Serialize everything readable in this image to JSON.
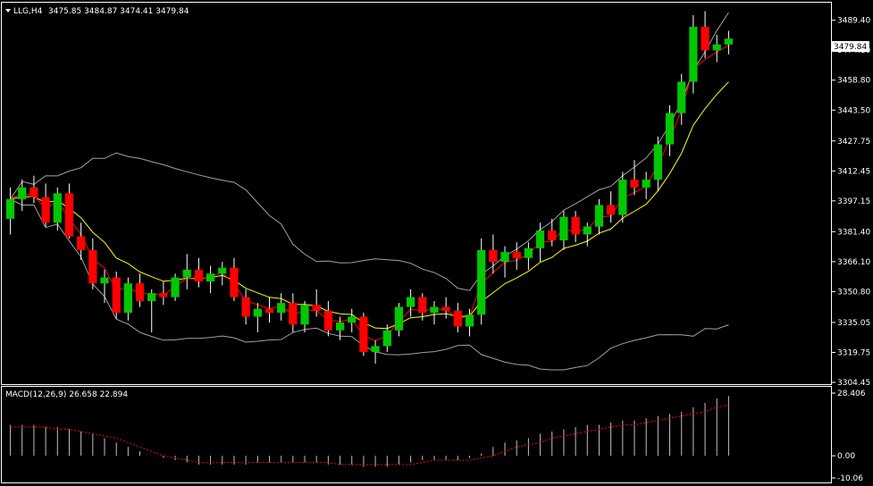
{
  "header": {
    "menu_icon": "triangle-down-icon",
    "symbol_text": "LLG,H4",
    "ohlc_text": "3475.85 3484.87 3474.41 3479.84"
  },
  "price_panel": {
    "current_price_label": "3479.84",
    "axis_ticks": [
      "3489.40",
      "3474.10",
      "3458.80",
      "3443.50",
      "3427.75",
      "3412.45",
      "3397.15",
      "3381.40",
      "3366.10",
      "3350.80",
      "3335.05",
      "3319.75",
      "3304.45"
    ]
  },
  "macd_panel": {
    "label": "MACD(12,26,9) 26.658 22.894",
    "axis_ticks": [
      "28.406",
      "0.00",
      "-10.06"
    ]
  },
  "colors": {
    "background": "#000000",
    "bull_candle": "#00c800",
    "bear_candle": "#ff0000",
    "wick": "#ffffff",
    "ma_fast": "#ff0000",
    "ma_slow": "#ffff00",
    "bollinger": "#a0a0a0",
    "macd_hist": "#c0c0c0",
    "macd_signal": "#ff0000",
    "frame": "#ffffff"
  },
  "chart_data": [
    {
      "type": "candlestick",
      "symbol": "LLG",
      "timeframe": "H4",
      "ohlc_last": {
        "open": 3475.85,
        "high": 3484.87,
        "low": 3474.41,
        "close": 3479.84
      },
      "ylim": [
        3304.45,
        3497.0
      ],
      "candles": [
        [
          3388,
          3404,
          3380,
          3398
        ],
        [
          3398,
          3408,
          3392,
          3404
        ],
        [
          3404,
          3410,
          3396,
          3399
        ],
        [
          3399,
          3406,
          3384,
          3386
        ],
        [
          3386,
          3404,
          3382,
          3401
        ],
        [
          3401,
          3406,
          3378,
          3379
        ],
        [
          3379,
          3386,
          3367,
          3372
        ],
        [
          3372,
          3378,
          3352,
          3355
        ],
        [
          3355,
          3362,
          3345,
          3358
        ],
        [
          3358,
          3361,
          3337,
          3340
        ],
        [
          3340,
          3358,
          3336,
          3355
        ],
        [
          3355,
          3360,
          3343,
          3346
        ],
        [
          3346,
          3352,
          3330,
          3350
        ],
        [
          3350,
          3356,
          3344,
          3348
        ],
        [
          3348,
          3360,
          3346,
          3358
        ],
        [
          3358,
          3370,
          3352,
          3362
        ],
        [
          3362,
          3368,
          3353,
          3356
        ],
        [
          3356,
          3364,
          3350,
          3360
        ],
        [
          3360,
          3366,
          3354,
          3363
        ],
        [
          3363,
          3368,
          3346,
          3348
        ],
        [
          3348,
          3352,
          3334,
          3338
        ],
        [
          3338,
          3345,
          3330,
          3342
        ],
        [
          3342,
          3348,
          3335,
          3340
        ],
        [
          3340,
          3350,
          3336,
          3345
        ],
        [
          3345,
          3350,
          3330,
          3334
        ],
        [
          3334,
          3346,
          3330,
          3344
        ],
        [
          3344,
          3352,
          3338,
          3341
        ],
        [
          3341,
          3346,
          3328,
          3331
        ],
        [
          3331,
          3338,
          3326,
          3335
        ],
        [
          3335,
          3342,
          3330,
          3338
        ],
        [
          3338,
          3340,
          3318,
          3320
        ],
        [
          3320,
          3326,
          3314,
          3323
        ],
        [
          3323,
          3334,
          3320,
          3331
        ],
        [
          3331,
          3345,
          3328,
          3343
        ],
        [
          3343,
          3352,
          3338,
          3348
        ],
        [
          3348,
          3350,
          3336,
          3340
        ],
        [
          3340,
          3346,
          3334,
          3343
        ],
        [
          3343,
          3348,
          3337,
          3341
        ],
        [
          3341,
          3345,
          3330,
          3333
        ],
        [
          3333,
          3342,
          3328,
          3339
        ],
        [
          3339,
          3378,
          3334,
          3372
        ],
        [
          3372,
          3380,
          3360,
          3366
        ],
        [
          3366,
          3374,
          3358,
          3371
        ],
        [
          3371,
          3376,
          3362,
          3368
        ],
        [
          3368,
          3376,
          3362,
          3373
        ],
        [
          3373,
          3386,
          3366,
          3382
        ],
        [
          3382,
          3388,
          3374,
          3377
        ],
        [
          3377,
          3392,
          3372,
          3389
        ],
        [
          3389,
          3392,
          3376,
          3380
        ],
        [
          3380,
          3386,
          3374,
          3384
        ],
        [
          3384,
          3398,
          3380,
          3395
        ],
        [
          3395,
          3402,
          3386,
          3390
        ],
        [
          3390,
          3412,
          3386,
          3408
        ],
        [
          3408,
          3418,
          3400,
          3404
        ],
        [
          3404,
          3412,
          3398,
          3408
        ],
        [
          3408,
          3430,
          3402,
          3426
        ],
        [
          3426,
          3446,
          3420,
          3442
        ],
        [
          3442,
          3462,
          3436,
          3458
        ],
        [
          3458,
          3492,
          3452,
          3486
        ],
        [
          3486,
          3494,
          3470,
          3474
        ],
        [
          3474,
          3482,
          3468,
          3477
        ],
        [
          3477,
          3484,
          3472,
          3480
        ]
      ]
    },
    {
      "type": "bar",
      "name": "MACD(12,26,9)",
      "current": {
        "macd": 26.658,
        "signal": 22.894
      },
      "ylim": [
        -10.06,
        28.406
      ],
      "histogram": [
        14,
        14,
        14,
        13,
        13,
        12,
        11,
        10,
        8,
        6,
        4,
        2,
        0,
        -1,
        -2,
        -3,
        -4,
        -4,
        -4,
        -4,
        -4,
        -3,
        -3,
        -3,
        -3,
        -3,
        -3,
        -4,
        -4,
        -4,
        -5,
        -5,
        -5,
        -4,
        -3,
        -2,
        -2,
        -2,
        -2,
        -1,
        1,
        4,
        6,
        7,
        8,
        10,
        11,
        12,
        13,
        14,
        14,
        15,
        16,
        16,
        17,
        18,
        19,
        20,
        22,
        24,
        26,
        27
      ],
      "signal": [
        13,
        13,
        13,
        13,
        12,
        12,
        11,
        10,
        9,
        8,
        6,
        4,
        2,
        0,
        -1,
        -2,
        -3,
        -3,
        -3,
        -3,
        -3,
        -3,
        -3,
        -3,
        -3,
        -3,
        -3,
        -3,
        -4,
        -4,
        -4,
        -4,
        -4,
        -4,
        -4,
        -3,
        -2,
        -2,
        -2,
        -2,
        -1,
        0,
        2,
        4,
        5,
        6,
        8,
        9,
        10,
        11,
        12,
        13,
        14,
        14,
        15,
        16,
        17,
        18,
        19,
        20,
        22,
        23
      ]
    }
  ]
}
